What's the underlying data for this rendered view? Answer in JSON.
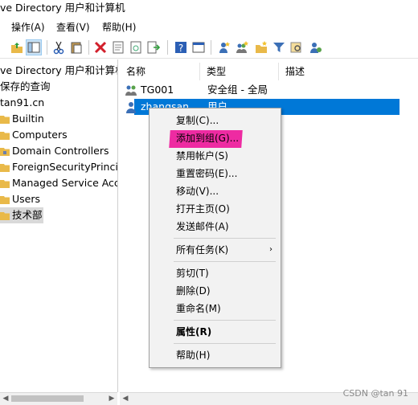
{
  "window": {
    "title": "ve Directory 用户和计算机"
  },
  "menubar": {
    "items": [
      "操作(A)",
      "查看(V)",
      "帮助(H)"
    ]
  },
  "tree": {
    "items": [
      {
        "label": "ve Directory 用户和计算机"
      },
      {
        "label": "保存的查询"
      },
      {
        "label": "tan91.cn"
      },
      {
        "label": "Builtin"
      },
      {
        "label": "Computers"
      },
      {
        "label": "Domain Controllers"
      },
      {
        "label": "ForeignSecurityPrincipa"
      },
      {
        "label": "Managed Service Acco"
      },
      {
        "label": "Users"
      },
      {
        "label": "技术部"
      }
    ]
  },
  "list": {
    "columns": [
      "名称",
      "类型",
      "描述"
    ],
    "rows": [
      {
        "name": "TG001",
        "type": "安全组 - 全局",
        "desc": ""
      },
      {
        "name": "zhangsan",
        "type": "用户",
        "desc": ""
      }
    ]
  },
  "context_menu": {
    "items": [
      {
        "label": "复制(C)..."
      },
      {
        "label": "添加到组(G)..."
      },
      {
        "label": "禁用帐户(S)"
      },
      {
        "label": "重置密码(E)..."
      },
      {
        "label": "移动(V)..."
      },
      {
        "label": "打开主页(O)"
      },
      {
        "label": "发送邮件(A)"
      },
      {
        "label": "所有任务(K)",
        "arrow": "›"
      },
      {
        "label": "剪切(T)"
      },
      {
        "label": "删除(D)"
      },
      {
        "label": "重命名(M)"
      },
      {
        "label": "属性(R)"
      },
      {
        "label": "帮助(H)"
      }
    ]
  },
  "colors": {
    "selection": "#0078d7",
    "highlight": "#ee2ba2"
  },
  "watermark": "CSDN @tan 91"
}
